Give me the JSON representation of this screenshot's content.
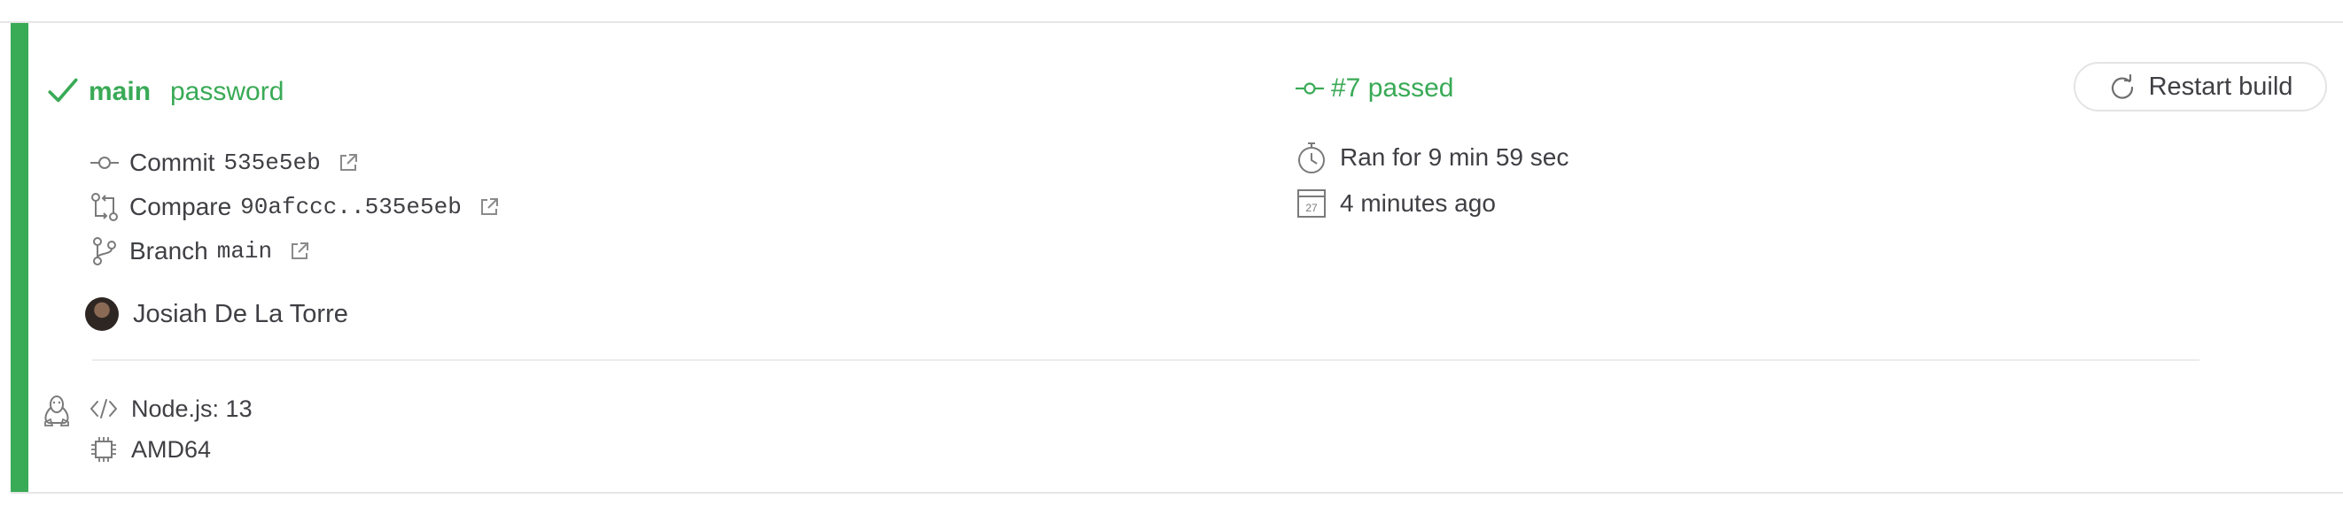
{
  "build": {
    "branch": "main",
    "message": "password",
    "status_icon": "check-icon",
    "number_text": "#7 passed",
    "commit_label": "Commit",
    "commit_sha": "535e5eb",
    "compare_label": "Compare",
    "compare_range": "90afccc..535e5eb",
    "branch_label": "Branch",
    "branch_value": "main",
    "author": "Josiah De La Torre",
    "duration": "Ran for 9 min 59 sec",
    "finished": "4 minutes ago",
    "restart_label": "Restart build"
  },
  "job_config": {
    "os_icon": "linux-icon",
    "language": "Node.js: 13",
    "arch": "AMD64"
  },
  "colors": {
    "passed": "#39aa56",
    "text": "#3f3f44",
    "border": "#e6e6e6"
  }
}
